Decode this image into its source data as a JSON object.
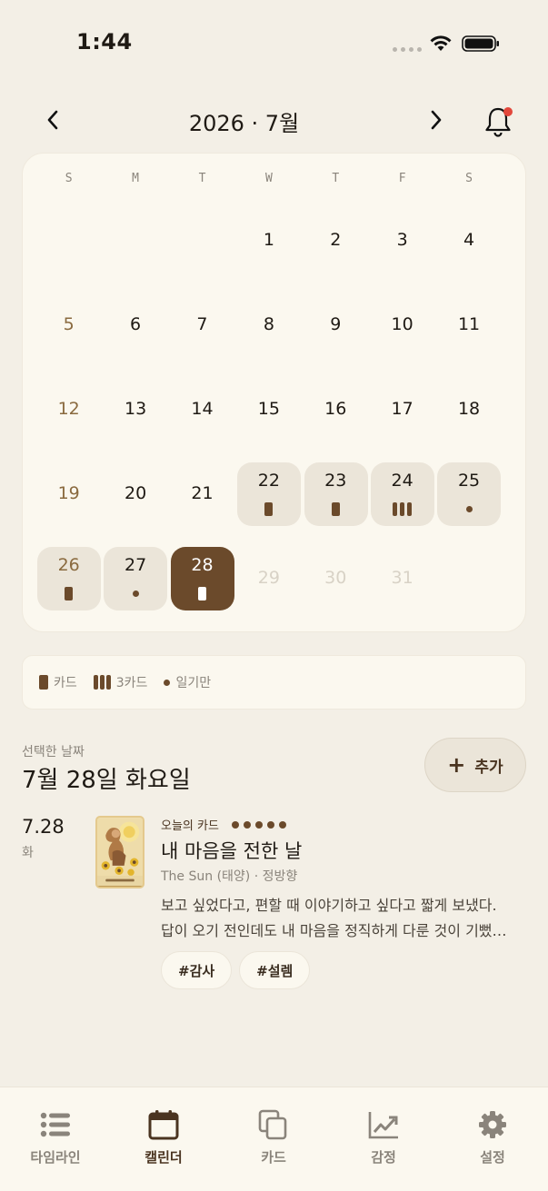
{
  "status_bar": {
    "time": "1:44"
  },
  "header": {
    "title": "2026 · 7월"
  },
  "calendar": {
    "weekdays": [
      "S",
      "M",
      "T",
      "W",
      "T",
      "F",
      "S"
    ],
    "days": [
      {
        "num": "",
        "type": "empty"
      },
      {
        "num": "",
        "type": "empty"
      },
      {
        "num": "",
        "type": "empty"
      },
      {
        "num": "1"
      },
      {
        "num": "2"
      },
      {
        "num": "3"
      },
      {
        "num": "4"
      },
      {
        "num": "5",
        "sunday": true
      },
      {
        "num": "6"
      },
      {
        "num": "7"
      },
      {
        "num": "8"
      },
      {
        "num": "9"
      },
      {
        "num": "10"
      },
      {
        "num": "11"
      },
      {
        "num": "12",
        "sunday": true
      },
      {
        "num": "13"
      },
      {
        "num": "14"
      },
      {
        "num": "15"
      },
      {
        "num": "16"
      },
      {
        "num": "17"
      },
      {
        "num": "18"
      },
      {
        "num": "19",
        "sunday": true
      },
      {
        "num": "20"
      },
      {
        "num": "21"
      },
      {
        "num": "22",
        "marker": "card"
      },
      {
        "num": "23",
        "marker": "card"
      },
      {
        "num": "24",
        "marker": "three"
      },
      {
        "num": "25",
        "marker": "diary"
      },
      {
        "num": "26",
        "sunday": true,
        "marker": "card"
      },
      {
        "num": "27",
        "marker": "diary"
      },
      {
        "num": "28",
        "marker": "card",
        "selected": true
      },
      {
        "num": "29",
        "faded": true
      },
      {
        "num": "30",
        "faded": true
      },
      {
        "num": "31",
        "faded": true
      }
    ]
  },
  "legend": {
    "card_label": "카드",
    "three_card_label": "3카드",
    "diary_label": "일기만"
  },
  "selected": {
    "label": "선택한 날짜",
    "date": "7월 28일 화요일",
    "add_label": "추가"
  },
  "entry": {
    "date": "7.28",
    "dow": "화",
    "tag_line": "오늘의 카드",
    "rating": 5,
    "title": "내 마음을 전한 날",
    "card_name": "The Sun (태양) · 정방향",
    "body_line1": "보고 싶었다고, 편할 때 이야기하고 싶다고 짧게 보냈다.",
    "body_line2": "답이 오기 전인데도 내 마음을 정직하게 다룬 것이 기뻤…",
    "tags": [
      "#감사",
      "#설렘"
    ]
  },
  "tabs": [
    {
      "label": "타임라인",
      "icon": "list-icon"
    },
    {
      "label": "캘린더",
      "icon": "calendar-icon",
      "active": true
    },
    {
      "label": "카드",
      "icon": "cards-icon"
    },
    {
      "label": "감정",
      "icon": "trend-chart-icon"
    },
    {
      "label": "설정",
      "icon": "gear-icon"
    }
  ],
  "colors": {
    "accent": "#6b4a2b",
    "background": "#f3efe6",
    "notification": "#e2473b"
  }
}
